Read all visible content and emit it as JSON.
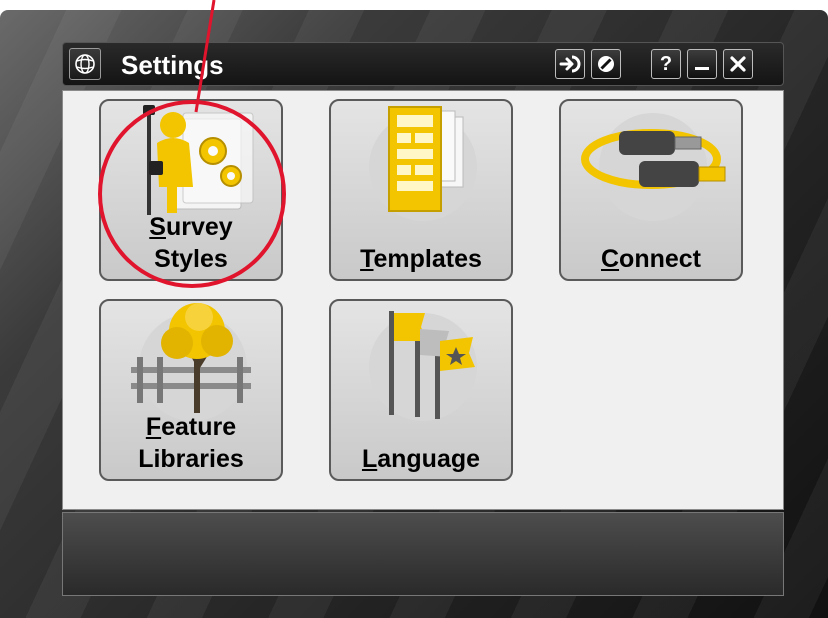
{
  "window": {
    "title": "Settings",
    "app_icon": "globe-icon",
    "buttons": [
      {
        "name": "exit-to-app-button",
        "icon": "arrow-right-icon",
        "label": ""
      },
      {
        "name": "cancel-button",
        "icon": "no-entry-icon",
        "label": ""
      },
      {
        "name": "help-button",
        "icon": "help-icon",
        "label": "?"
      },
      {
        "name": "minimize-button",
        "icon": "minimize-icon",
        "label": "–"
      },
      {
        "name": "close-button",
        "icon": "close-icon",
        "label": "✕"
      }
    ]
  },
  "tiles": [
    {
      "name": "survey-styles",
      "line1_first": "S",
      "line1_rest": "urvey",
      "line2": "Styles",
      "icon": "surveyor-gears-icon"
    },
    {
      "name": "templates",
      "line1_first": "T",
      "line1_rest": "emplates",
      "line2": "",
      "icon": "template-document-icon"
    },
    {
      "name": "connect",
      "line1_first": "C",
      "line1_rest": "onnect",
      "line2": "",
      "icon": "usb-cable-icon"
    },
    {
      "name": "feature-libraries",
      "line1_first": "F",
      "line1_rest": "eature",
      "line2": "Libraries",
      "icon": "tree-fence-icon"
    },
    {
      "name": "language",
      "line1_first": "L",
      "line1_rest": "anguage",
      "line2": "",
      "icon": "flags-icon"
    }
  ],
  "colors": {
    "annotation": "#e0142c",
    "accent_yellow": "#f2c500"
  }
}
